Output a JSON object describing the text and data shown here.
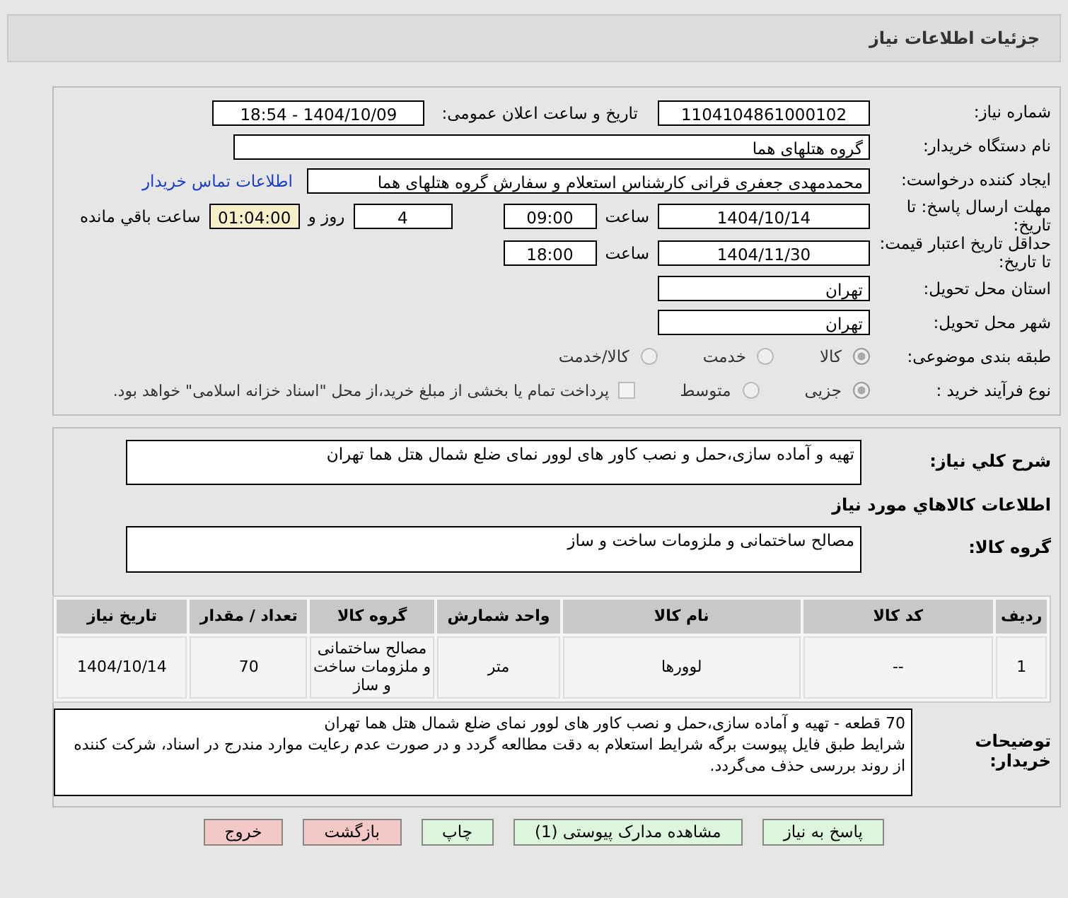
{
  "title": "جزئیات اطلاعات نیاز",
  "need_number": {
    "label": "شماره نیاز:",
    "value": "1104104861000102"
  },
  "announce": {
    "label": "تاریخ و ساعت اعلان عمومی:",
    "value": "1404/10/09 - 18:54"
  },
  "buyer": {
    "label": "نام دستگاه خریدار:",
    "value": "گروه هتلهای هما"
  },
  "creator": {
    "label": "ایجاد کننده درخواست:",
    "value": "محمدمهدی جعفری قرانی کارشناس استعلام و سفارش گروه هتلهای هما",
    "link": "اطلاعات تماس خریدار"
  },
  "deadline": {
    "label": "مهلت ارسال پاسخ: تا تاریخ:",
    "date": "1404/10/14",
    "time_label": "ساعت",
    "time": "09:00",
    "days": "4",
    "days_label": "روز و",
    "remaining": "01:04:00",
    "remaining_label": "ساعت باقي مانده"
  },
  "validity": {
    "label": "حداقل تاریخ اعتبار قیمت: تا تاریخ:",
    "date": "1404/11/30",
    "time_label": "ساعت",
    "time": "18:00"
  },
  "province": {
    "label": "استان محل تحویل:",
    "value": "تهران"
  },
  "city": {
    "label": "شهر محل تحویل:",
    "value": "تهران"
  },
  "category": {
    "label": "طبقه بندی موضوعی:",
    "options": [
      {
        "label": "کالا",
        "selected": true
      },
      {
        "label": "خدمت",
        "selected": false
      },
      {
        "label": "کالا/خدمت",
        "selected": false
      }
    ]
  },
  "process": {
    "label": "نوع فرآیند خرید :",
    "options": [
      {
        "label": "جزیی",
        "selected": true
      },
      {
        "label": "متوسط",
        "selected": false
      }
    ],
    "payment": {
      "checked": false,
      "text": "پرداخت تمام یا بخشی از مبلغ خرید،از محل \"اسناد خزانه اسلامی\" خواهد بود."
    }
  },
  "description": {
    "label": "شرح کلي نياز:",
    "value": "تهیه و آماده سازی،حمل و نصب کاور های لوور نمای ضلع شمال هتل هما تهران"
  },
  "goods_heading": "اطلاعات کالاهاي مورد نياز",
  "goods_group": {
    "label": "گروه کالا:",
    "value": "مصالح ساختمانی و ملزومات ساخت و ساز"
  },
  "table": {
    "columns": [
      "ردیف",
      "کد کالا",
      "نام کالا",
      "واحد شمارش",
      "گروه کالا",
      "تعداد / مقدار",
      "تاریخ نیاز"
    ],
    "rows": [
      [
        "1",
        "--",
        "لوورها",
        "متر",
        "مصالح ساختمانی و ملزومات ساخت و ساز",
        "70",
        "1404/10/14"
      ]
    ]
  },
  "notes": {
    "label": "توضیحات خریدار:",
    "lines": [
      "70 قطعه - تهیه و آماده سازی،حمل و نصب کاور های لوور نمای ضلع شمال هتل هما تهران",
      " شرایط طبق فایل پیوست برگه شرایط استعلام به دقت مطالعه گردد و در صورت عدم رعایت موارد مندرج در اسناد، شرکت کننده از روند بررسی حذف می‌گردد."
    ]
  },
  "buttons": [
    {
      "label": "پاسخ به نیاز",
      "kind": "green"
    },
    {
      "label": "مشاهده مدارک پیوستی (1)",
      "kind": "green"
    },
    {
      "label": "چاپ",
      "kind": "green"
    },
    {
      "label": "بازگشت",
      "kind": "pink"
    },
    {
      "label": "خروج",
      "kind": "pink"
    }
  ]
}
